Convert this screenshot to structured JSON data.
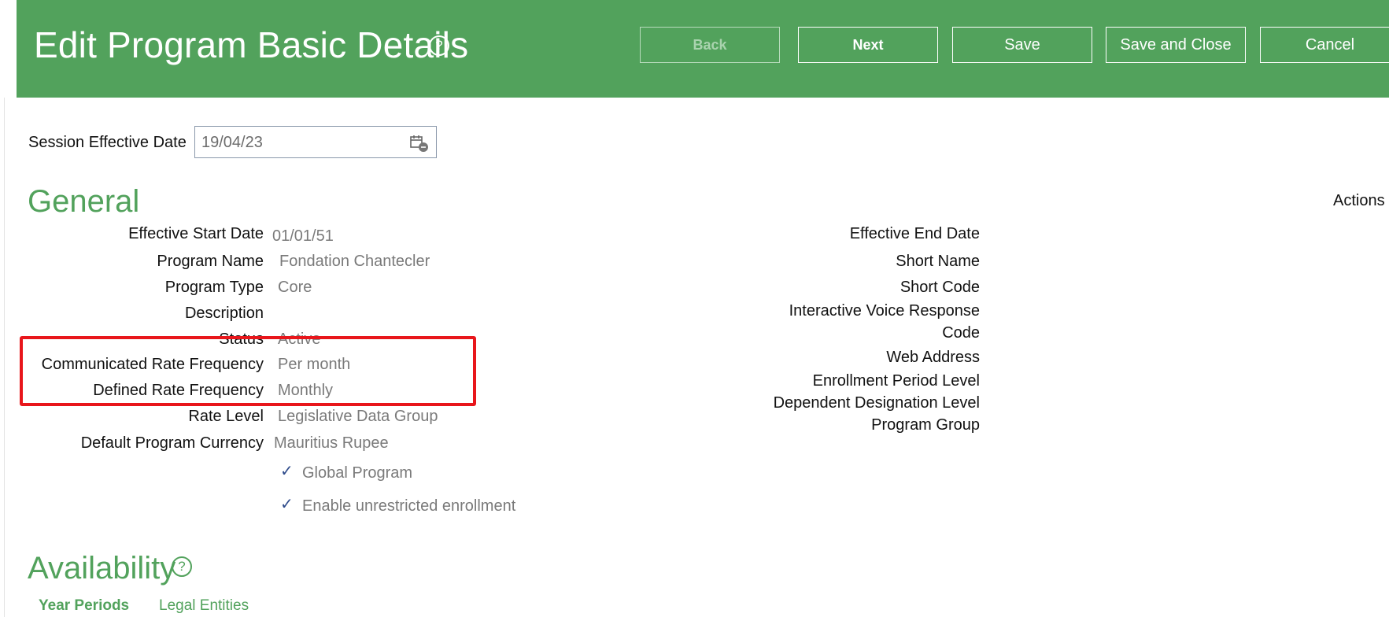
{
  "header": {
    "title": "Edit Program Basic Details",
    "help_icon": "?",
    "buttons": {
      "back": "Back",
      "next": "Next",
      "save": "Save",
      "save_and_close": "Save and Close",
      "cancel": "Cancel"
    }
  },
  "session": {
    "label": "Session Effective Date",
    "value": "19/04/23"
  },
  "general": {
    "title": "General",
    "actions_label": "Actions",
    "left_fields": {
      "effective_start_date": {
        "label": "Effective Start Date",
        "value": "01/01/51"
      },
      "program_name": {
        "label": "Program Name",
        "value": "Fondation Chantecler"
      },
      "program_type": {
        "label": "Program Type",
        "value": "Core"
      },
      "description": {
        "label": "Description",
        "value": ""
      },
      "status": {
        "label": "Status",
        "value": "Active"
      },
      "communicated_rate_frequency": {
        "label": "Communicated Rate Frequency",
        "value": "Per month"
      },
      "defined_rate_frequency": {
        "label": "Defined Rate Frequency",
        "value": "Monthly"
      },
      "rate_level": {
        "label": "Rate Level",
        "value": "Legislative Data Group"
      },
      "default_program_currency": {
        "label": "Default Program Currency",
        "value": "Mauritius Rupee"
      }
    },
    "checkboxes": {
      "global_program": {
        "label": "Global Program",
        "checked": true
      },
      "enable_unrestricted_enrollment": {
        "label": "Enable unrestricted enrollment",
        "checked": true
      }
    },
    "right_fields": {
      "effective_end_date": "Effective End Date",
      "short_name": "Short Name",
      "short_code": "Short Code",
      "ivr_code_line1": "Interactive Voice Response",
      "ivr_code_line2": "Code",
      "web_address": "Web Address",
      "enrollment_period_level": "Enrollment Period Level",
      "dependent_designation_level": "Dependent Designation Level",
      "program_group": "Program Group"
    }
  },
  "availability": {
    "title": "Availability",
    "tabs": [
      "Year Periods",
      "Legal Entities"
    ]
  },
  "colors": {
    "header_green": "#52a25c",
    "highlight_red": "#e8161b",
    "value_gray": "#7a7a7a"
  },
  "icons": [
    "help-icon",
    "calendar-icon",
    "checkmark-icon"
  ]
}
